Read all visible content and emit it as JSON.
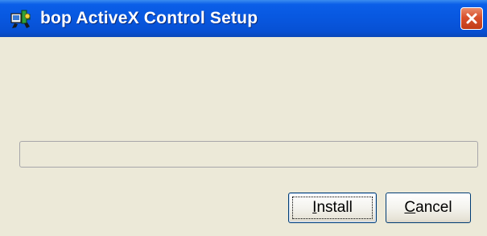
{
  "window": {
    "title": "bop ActiveX Control Setup",
    "icon": "setup-installer-icon",
    "close_icon": "close-icon"
  },
  "progress": {
    "value": 0
  },
  "buttons": {
    "install": {
      "mnemonic": "I",
      "rest": "nstall"
    },
    "cancel": {
      "mnemonic": "C",
      "rest": "ancel"
    }
  },
  "colors": {
    "titlebar": "#0857df",
    "close_button": "#d8502c",
    "dialog_background": "#ece9d8"
  }
}
